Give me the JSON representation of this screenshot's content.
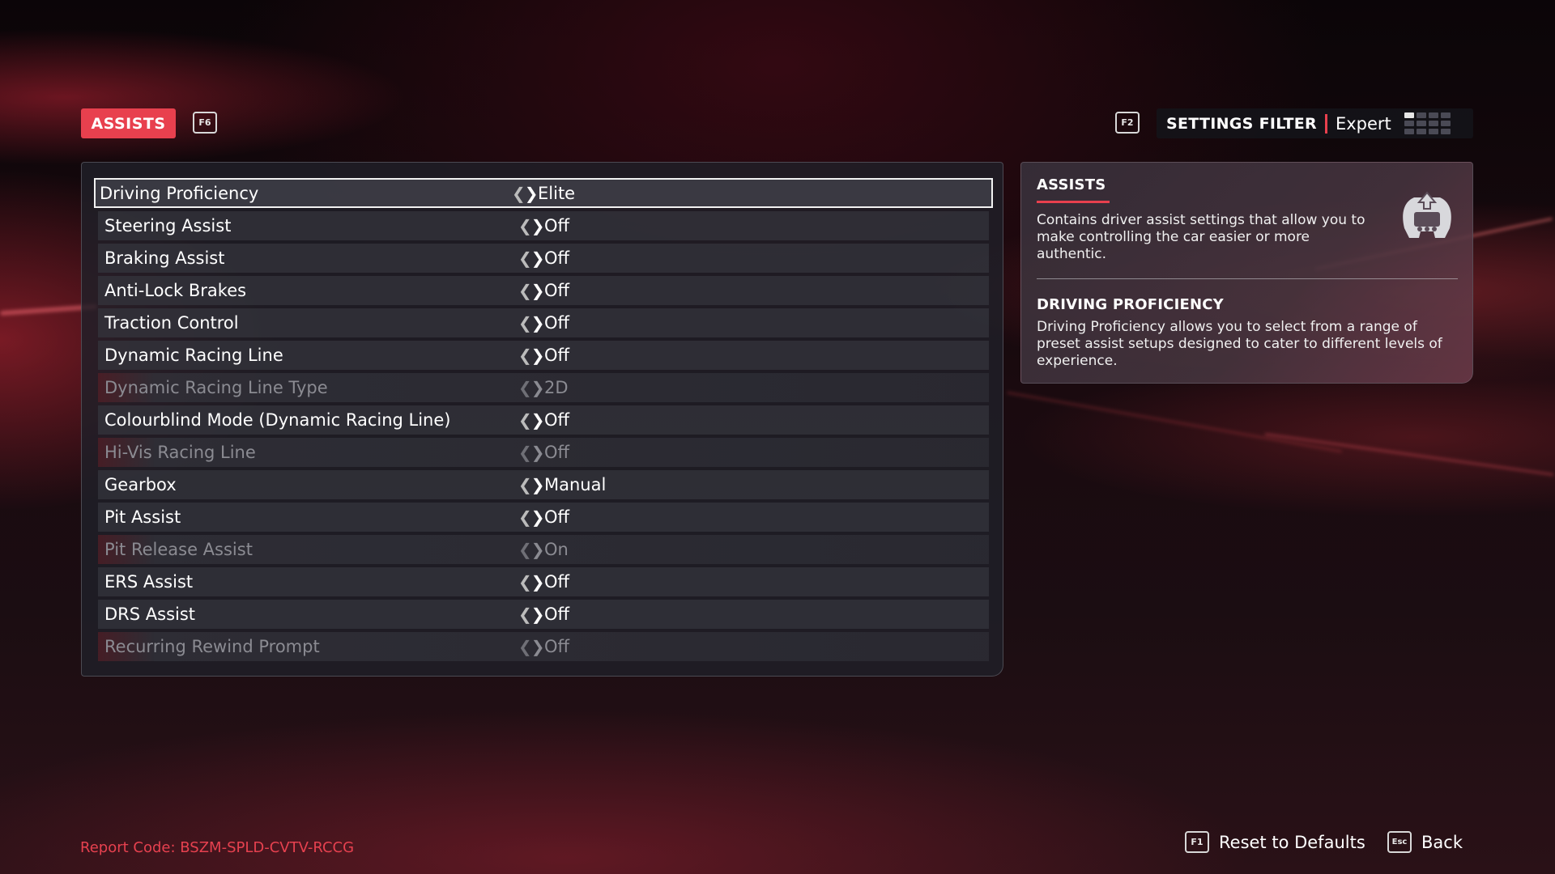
{
  "header": {
    "tab_label": "ASSISTS",
    "tab_key": "F6",
    "filter_key": "F2",
    "filter_label": "SETTINGS FILTER",
    "filter_value": "Expert",
    "filter_level": 1
  },
  "settings": [
    {
      "label": "Driving Proficiency",
      "value": "Elite",
      "selected": true,
      "enabled": true
    },
    {
      "label": "Steering Assist",
      "value": "Off",
      "selected": false,
      "enabled": true
    },
    {
      "label": "Braking Assist",
      "value": "Off",
      "selected": false,
      "enabled": true
    },
    {
      "label": "Anti-Lock Brakes",
      "value": "Off",
      "selected": false,
      "enabled": true
    },
    {
      "label": "Traction Control",
      "value": "Off",
      "selected": false,
      "enabled": true
    },
    {
      "label": "Dynamic Racing Line",
      "value": "Off",
      "selected": false,
      "enabled": true
    },
    {
      "label": "Dynamic Racing Line Type",
      "value": "2D",
      "selected": false,
      "enabled": false
    },
    {
      "label": "Colourblind Mode (Dynamic Racing Line)",
      "value": "Off",
      "selected": false,
      "enabled": true
    },
    {
      "label": "Hi-Vis Racing Line",
      "value": "Off",
      "selected": false,
      "enabled": false
    },
    {
      "label": "Gearbox",
      "value": "Manual",
      "selected": false,
      "enabled": true
    },
    {
      "label": "Pit Assist",
      "value": "Off",
      "selected": false,
      "enabled": true
    },
    {
      "label": "Pit Release Assist",
      "value": "On",
      "selected": false,
      "enabled": false
    },
    {
      "label": "ERS Assist",
      "value": "Off",
      "selected": false,
      "enabled": true
    },
    {
      "label": "DRS Assist",
      "value": "Off",
      "selected": false,
      "enabled": true
    },
    {
      "label": "Recurring Rewind Prompt",
      "value": "Off",
      "selected": false,
      "enabled": false
    }
  ],
  "info": {
    "title": "ASSISTS",
    "description": "Contains driver assist settings that allow you to make controlling the car easier or more authentic.",
    "icon": "steering-wheel-icon",
    "detail_title": "DRIVING PROFICIENCY",
    "detail_text": "Driving Proficiency allows you to select from a range of preset assist setups designed to cater to different levels of experience."
  },
  "footer": {
    "report_code": "Report Code: BSZM-SPLD-CVTV-RCCG",
    "reset_key": "F1",
    "reset_label": "Reset to Defaults",
    "back_key": "Esc",
    "back_label": "Back"
  },
  "colors": {
    "accent": "#e8404e",
    "panel": "#202028",
    "row": "#34343c"
  }
}
